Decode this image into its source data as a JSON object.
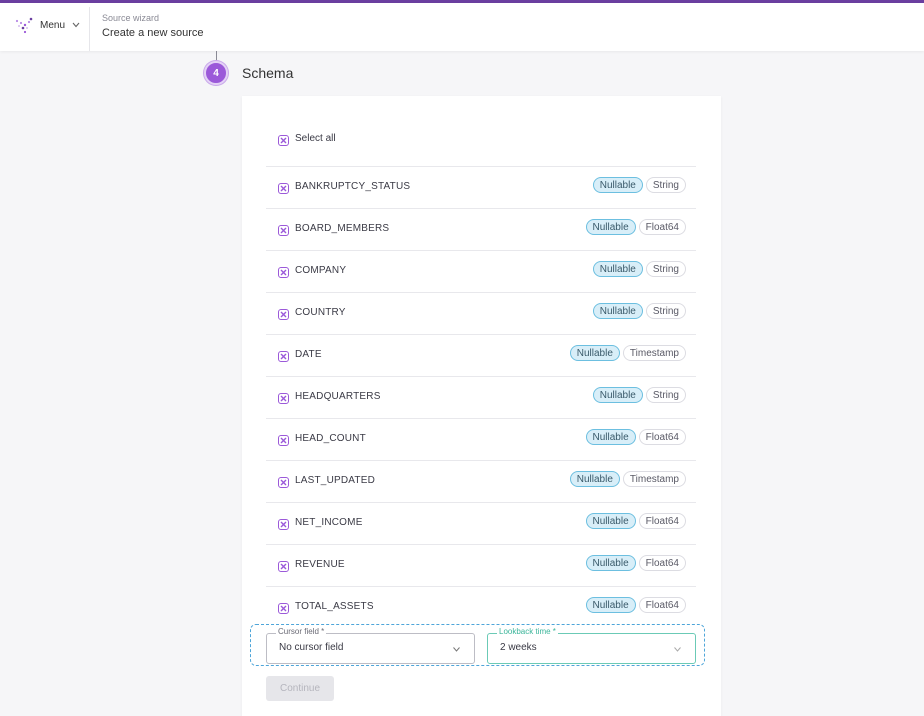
{
  "header": {
    "menu_label": "Menu",
    "breadcrumb_small": "Source wizard",
    "breadcrumb_main": "Create a new source"
  },
  "step": {
    "number": "4",
    "title": "Schema"
  },
  "schema": {
    "select_all_label": "Select all",
    "fields": [
      {
        "name": "BANKRUPTCY_STATUS",
        "nullable": "Nullable",
        "type": "String"
      },
      {
        "name": "BOARD_MEMBERS",
        "nullable": "Nullable",
        "type": "Float64"
      },
      {
        "name": "COMPANY",
        "nullable": "Nullable",
        "type": "String"
      },
      {
        "name": "COUNTRY",
        "nullable": "Nullable",
        "type": "String"
      },
      {
        "name": "DATE",
        "nullable": "Nullable",
        "type": "Timestamp"
      },
      {
        "name": "HEADQUARTERS",
        "nullable": "Nullable",
        "type": "String"
      },
      {
        "name": "HEAD_COUNT",
        "nullable": "Nullable",
        "type": "Float64"
      },
      {
        "name": "LAST_UPDATED",
        "nullable": "Nullable",
        "type": "Timestamp"
      },
      {
        "name": "NET_INCOME",
        "nullable": "Nullable",
        "type": "Float64"
      },
      {
        "name": "REVENUE",
        "nullable": "Nullable",
        "type": "Float64"
      },
      {
        "name": "TOTAL_ASSETS",
        "nullable": "Nullable",
        "type": "Float64"
      }
    ]
  },
  "cursor_field": {
    "label": "Cursor field *",
    "value": "No cursor field"
  },
  "lookback_time": {
    "label": "Lookback time *",
    "value": "2 weeks"
  },
  "continue_label": "Continue",
  "colors": {
    "accent": "#9b59d9",
    "brand_bar": "#6b3fa0",
    "nullable_pill": "#d8eef8",
    "focus_outline": "#4ea5d9"
  }
}
